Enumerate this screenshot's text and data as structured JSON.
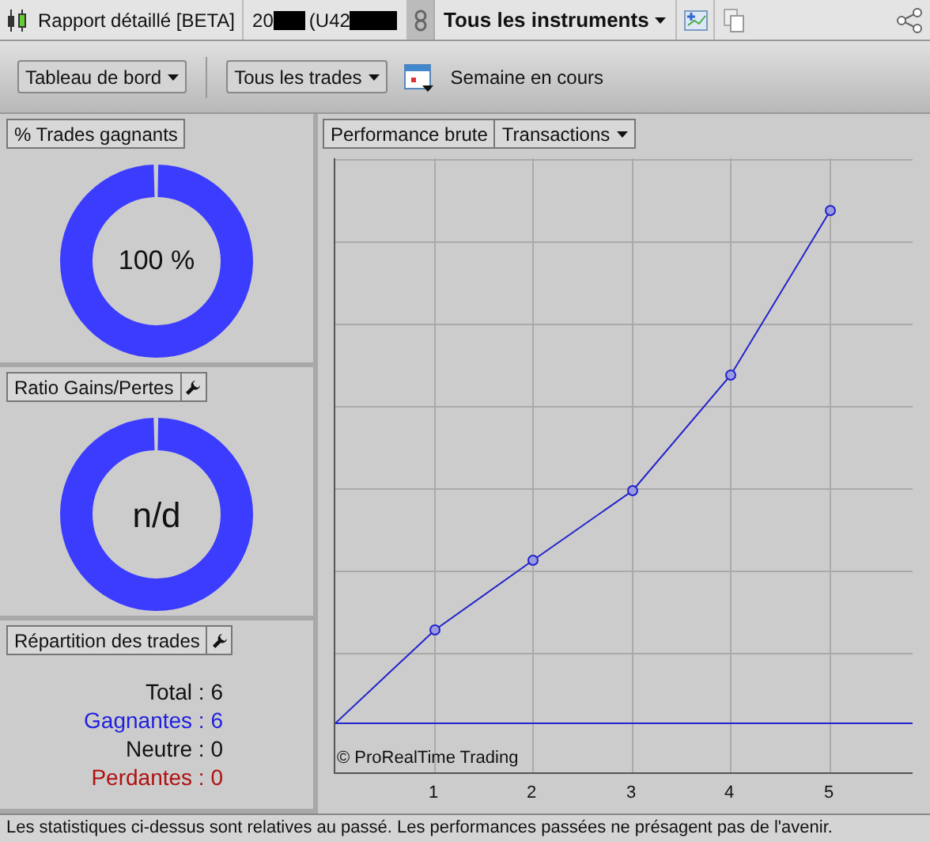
{
  "header": {
    "app_title": "Rapport détaillé [BETA]",
    "account_prefix": "20",
    "account_id": "(U42",
    "instrument_menu": "Tous les instruments"
  },
  "toolbar": {
    "dashboard_menu": "Tableau de bord",
    "trades_menu": "Tous les trades",
    "period": "Semaine en cours"
  },
  "panels": [
    {
      "kind": "donut",
      "title": "% Trades gagnants",
      "settings": false,
      "value": "100 %"
    },
    {
      "kind": "donut",
      "title": "Ratio Gains/Pertes",
      "settings": true,
      "value": "n/d"
    },
    {
      "kind": "list",
      "title": "Répartition des trades",
      "settings": true,
      "rows": [
        {
          "label": "Total : 6",
          "color": "#111111"
        },
        {
          "label": "Gagnantes : 6",
          "color": "#1f1fe0"
        },
        {
          "label": "Neutre : 0",
          "color": "#111111"
        },
        {
          "label": "Perdantes : 0",
          "color": "#b01010"
        }
      ]
    }
  ],
  "performance": {
    "title": "Performance brute",
    "menu": "Transactions",
    "copyright": "© ProRealTime Trading",
    "x_labels": [
      "1",
      "2",
      "3",
      "4",
      "5"
    ]
  },
  "status_bar": "Les statistiques ci-dessus sont relatives au passé. Les performances passées ne présagent pas de l'avenir."
}
